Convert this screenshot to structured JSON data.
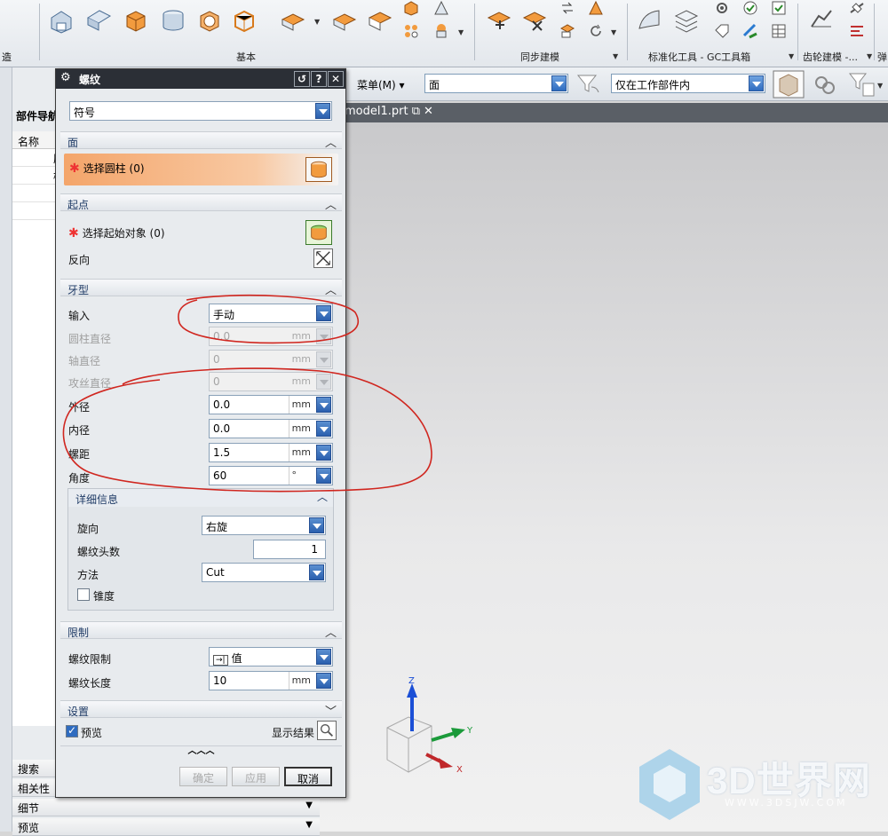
{
  "ribbon": {
    "left_label": "造",
    "groups": [
      {
        "label": "基本"
      },
      {
        "label": "同步建模"
      },
      {
        "label": "标准化工具 - GC工具箱"
      },
      {
        "label": "齿轮建模 -..."
      },
      {
        "label": "弹"
      }
    ]
  },
  "selection_bar": {
    "menu": "菜单(M)",
    "filter": "面",
    "scope": "仅在工作部件内"
  },
  "tab": {
    "name": "model1.prt"
  },
  "navigator": {
    "title": "部件导航",
    "column": "名称",
    "rows": [
      "历",
      "模",
      "",
      ""
    ],
    "bottom": [
      "搜索",
      "相关性",
      "细节",
      "预览"
    ]
  },
  "dialog": {
    "title": "螺纹",
    "type_select": "符号",
    "face": {
      "header": "面",
      "select": "选择圆柱 (0)"
    },
    "start": {
      "header": "起点",
      "select": "选择起始对象 (0)",
      "reverse": "反向"
    },
    "thread_type": {
      "header": "牙型",
      "input_label": "输入",
      "input_value": "手动",
      "cyl_dia_label": "圆柱直径",
      "cyl_dia_value": "0.0",
      "shaft_dia_label": "轴直径",
      "shaft_dia_value": "0",
      "tap_dia_label": "攻丝直径",
      "tap_dia_value": "0",
      "outer_label": "外径",
      "outer_value": "0.0",
      "inner_label": "内径",
      "inner_value": "0.0",
      "pitch_label": "螺距",
      "pitch_value": "1.5",
      "angle_label": "角度",
      "angle_value": "60",
      "unit_mm": "mm",
      "unit_deg": "°"
    },
    "details": {
      "header": "详细信息",
      "hand_label": "旋向",
      "hand_value": "右旋",
      "starts_label": "螺纹头数",
      "starts_value": "1",
      "method_label": "方法",
      "method_value": "Cut",
      "taper_label": "锥度"
    },
    "limits": {
      "header": "限制",
      "limit_label": "螺纹限制",
      "limit_value": "值",
      "length_label": "螺纹长度",
      "length_value": "10",
      "unit_mm": "mm"
    },
    "settings": {
      "header": "设置"
    },
    "preview_label": "预览",
    "show_result": "显示结果",
    "buttons": {
      "ok": "确定",
      "apply": "应用",
      "cancel": "取消"
    }
  },
  "triad": {
    "z": "Z",
    "y": "Y",
    "x": "X"
  },
  "watermark": {
    "name": "3D世界网",
    "url": "WWW.3DSJW.COM"
  }
}
